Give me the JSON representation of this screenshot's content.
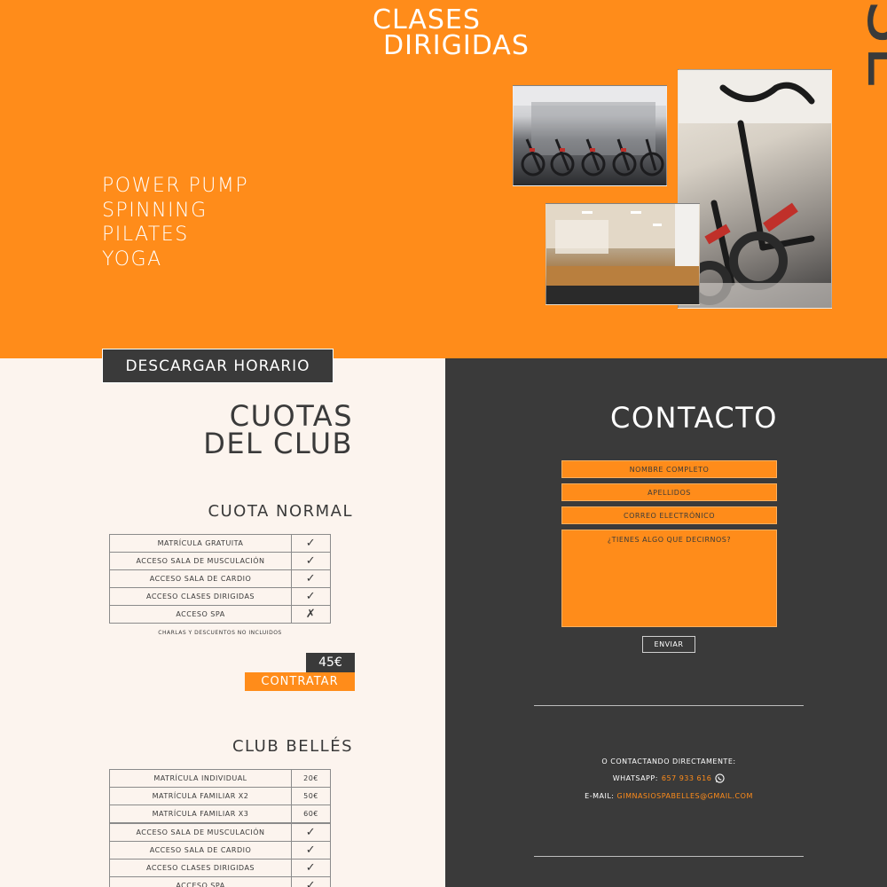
{
  "hero": {
    "title_line1": "CLASES",
    "title_line2": "DIRIGIDAS",
    "side_text": "SE",
    "classes": [
      "POWER PUMP",
      "SPINNING",
      "PILATES",
      "YOGA"
    ],
    "bg_color": "#ff8c1a"
  },
  "schedule_button": "DESCARGAR HORARIO",
  "fees": {
    "title_line1": "CUOTAS",
    "title_line2": "DEL CLUB",
    "normal": {
      "heading": "CUOTA NORMAL",
      "rows": [
        {
          "label": "MATRÍCULA GRATUITA",
          "mark": "✓"
        },
        {
          "label": "ACCESO SALA DE MUSCULACIÓN",
          "mark": "✓"
        },
        {
          "label": "ACCESO SALA DE CARDIO",
          "mark": "✓"
        },
        {
          "label": "ACCESO CLASES DIRIGIDAS",
          "mark": "✓"
        },
        {
          "label": "ACCESO SPA",
          "mark": "✗"
        }
      ],
      "note": "CHARLAS Y DESCUENTOS NO INCLUIDOS",
      "price": "45€",
      "cta": "CONTRATAR"
    },
    "belles": {
      "heading": "CLUB BELLÉS",
      "price_rows": [
        {
          "label": "MATRÍCULA INDIVIDUAL",
          "value": "20€"
        },
        {
          "label": "MATRÍCULA FAMILIAR X2",
          "value": "50€"
        },
        {
          "label": "MATRÍCULA FAMILIAR X3",
          "value": "60€"
        }
      ],
      "rows": [
        {
          "label": "ACCESO SALA DE MUSCULACIÓN",
          "mark": "✓"
        },
        {
          "label": "ACCESO SALA DE CARDIO",
          "mark": "✓"
        },
        {
          "label": "ACCESO CLASES DIRIGIDAS",
          "mark": "✓"
        },
        {
          "label": "ACCESO SPA",
          "mark": "✓"
        }
      ]
    }
  },
  "contact": {
    "title": "CONTACTO",
    "fields": {
      "name": "NOMBRE COMPLETO",
      "surname": "APELLIDOS",
      "email": "CORREO ELECTRÓNICO",
      "message": "¿TIENES ALGO QUE DECIRNOS?"
    },
    "submit": "ENVIAR",
    "direct_label": "O CONTACTANDO DIRECTAMENTE:",
    "whatsapp_label": "WHATSAPP:",
    "whatsapp_number": "657 933 616",
    "email_label": "E-MAIL:",
    "email_address": "GIMNASIOSPABELLES@GMAIL.COM",
    "accent_color": "#ff8c1a",
    "bg_color": "#3a3a3a"
  },
  "icons": {
    "check": "check-icon",
    "cross": "cross-icon",
    "whatsapp": "whatsapp-icon"
  }
}
